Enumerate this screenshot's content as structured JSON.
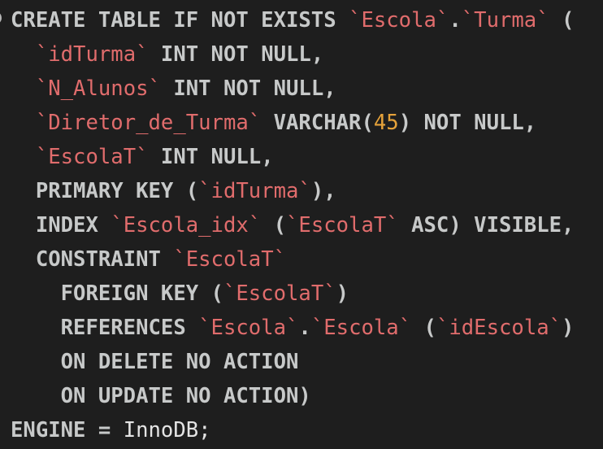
{
  "editor": {
    "lines": [
      [
        {
          "t": "CREATE TABLE IF NOT EXISTS ",
          "c": "kw"
        },
        {
          "t": "`Escola`",
          "c": "ident"
        },
        {
          "t": ".",
          "c": "kw"
        },
        {
          "t": "`Turma`",
          "c": "ident"
        },
        {
          "t": " (",
          "c": "kw"
        }
      ],
      [
        {
          "t": "  ",
          "c": "kw"
        },
        {
          "t": "`idTurma`",
          "c": "ident"
        },
        {
          "t": " INT NOT NULL,",
          "c": "kw"
        }
      ],
      [
        {
          "t": "  ",
          "c": "kw"
        },
        {
          "t": "`N_Alunos`",
          "c": "ident"
        },
        {
          "t": " INT NOT NULL,",
          "c": "kw"
        }
      ],
      [
        {
          "t": "  ",
          "c": "kw"
        },
        {
          "t": "`Diretor_de_Turma`",
          "c": "ident"
        },
        {
          "t": " VARCHAR(",
          "c": "kw"
        },
        {
          "t": "45",
          "c": "num"
        },
        {
          "t": ") NOT NULL,",
          "c": "kw"
        }
      ],
      [
        {
          "t": "  ",
          "c": "kw"
        },
        {
          "t": "`EscolaT`",
          "c": "ident"
        },
        {
          "t": " INT NULL,",
          "c": "kw"
        }
      ],
      [
        {
          "t": "  PRIMARY KEY (",
          "c": "kw"
        },
        {
          "t": "`idTurma`",
          "c": "ident"
        },
        {
          "t": "),",
          "c": "kw"
        }
      ],
      [
        {
          "t": "  INDEX ",
          "c": "kw"
        },
        {
          "t": "`Escola_idx`",
          "c": "ident"
        },
        {
          "t": " (",
          "c": "kw"
        },
        {
          "t": "`EscolaT`",
          "c": "ident"
        },
        {
          "t": " ASC) VISIBLE,",
          "c": "kw"
        }
      ],
      [
        {
          "t": "  CONSTRAINT ",
          "c": "kw"
        },
        {
          "t": "`EscolaT`",
          "c": "ident"
        }
      ],
      [
        {
          "t": "    FOREIGN KEY (",
          "c": "kw"
        },
        {
          "t": "`EscolaT`",
          "c": "ident"
        },
        {
          "t": ")",
          "c": "kw"
        }
      ],
      [
        {
          "t": "    REFERENCES ",
          "c": "kw"
        },
        {
          "t": "`Escola`",
          "c": "ident"
        },
        {
          "t": ".",
          "c": "kw"
        },
        {
          "t": "`Escola`",
          "c": "ident"
        },
        {
          "t": " (",
          "c": "kw"
        },
        {
          "t": "`idEscola`",
          "c": "ident"
        },
        {
          "t": ")",
          "c": "kw"
        }
      ],
      [
        {
          "t": "    ON DELETE NO ACTION",
          "c": "kw"
        }
      ],
      [
        {
          "t": "    ON UPDATE NO ACTION)",
          "c": "kw"
        }
      ],
      [
        {
          "t": "ENGINE = ",
          "c": "kw"
        },
        {
          "t": "InnoDB;",
          "c": "plain"
        }
      ]
    ]
  },
  "colors": {
    "background": "#1e1e1e",
    "keyword": "#c7c9c9",
    "identifier": "#e06c6c",
    "number": "#e5a23a",
    "plain": "#e4e4e4"
  }
}
